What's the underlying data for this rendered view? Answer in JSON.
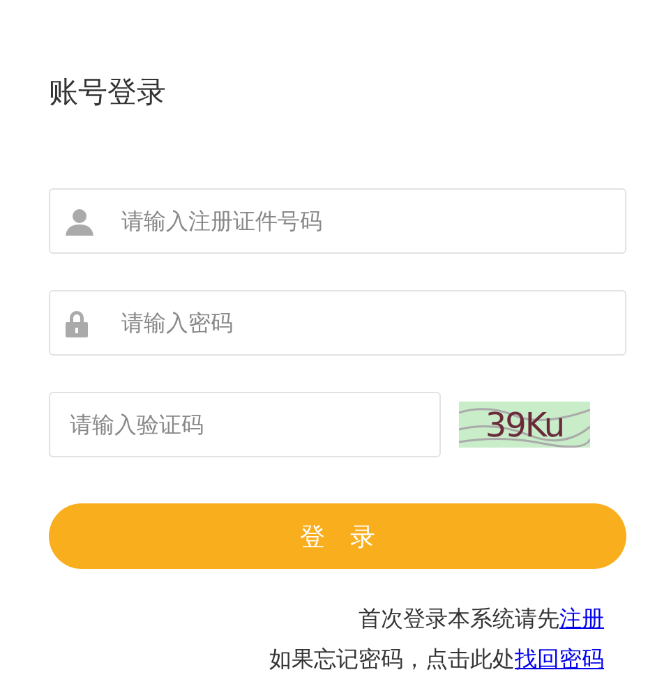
{
  "title": "账号登录",
  "fields": [
    {
      "kind": "user",
      "placeholder": "请输入注册证件号码"
    },
    {
      "kind": "lock",
      "placeholder": "请输入密码"
    }
  ],
  "captcha": {
    "placeholder": "请输入验证码",
    "code": "39Ku"
  },
  "login_button": "登　录",
  "notes": [
    {
      "text": "首次登录本系统请先",
      "link": "注册"
    },
    {
      "text": "如果忘记密码，点击此处",
      "link": "找回密码"
    }
  ]
}
